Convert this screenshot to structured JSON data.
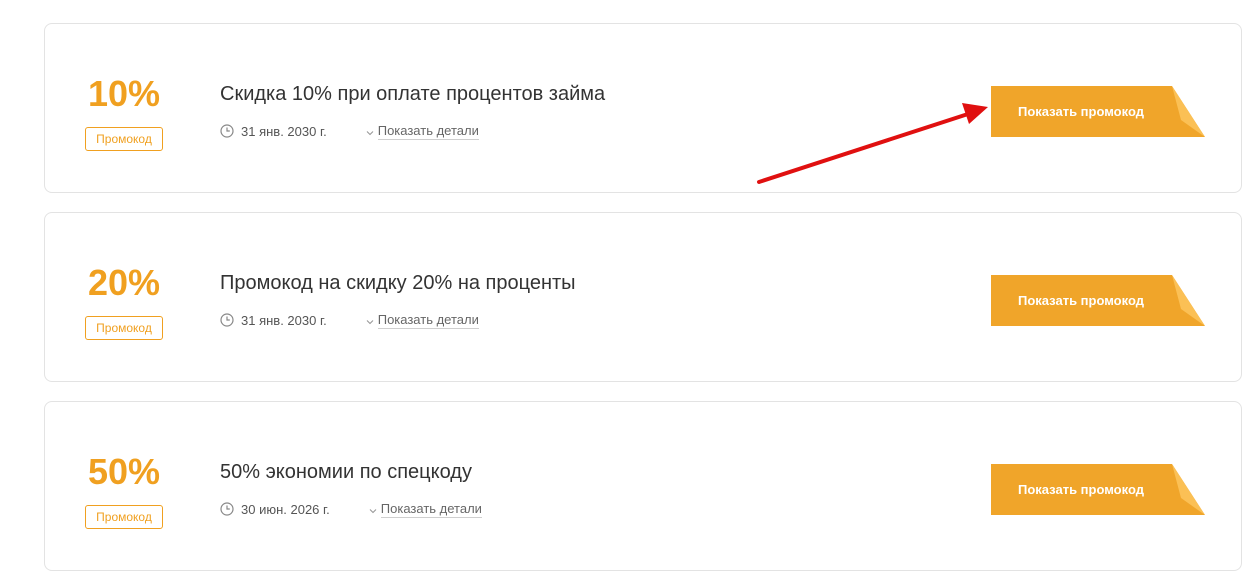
{
  "offers": [
    {
      "percent": "10%",
      "tag": "Промокод",
      "title": "Скидка 10% при оплате процентов займа",
      "date": "31 янв. 2030 г.",
      "details": "Показать детали",
      "button": "Показать промокод"
    },
    {
      "percent": "20%",
      "tag": "Промокод",
      "title": "Промокод на скидку 20% на проценты",
      "date": "31 янв. 2030 г.",
      "details": "Показать детали",
      "button": "Показать промокод"
    },
    {
      "percent": "50%",
      "tag": "Промокод",
      "title": "50% экономии по спецкоду",
      "date": "30 июн. 2026 г.",
      "details": "Показать детали",
      "button": "Показать промокод"
    }
  ],
  "colors": {
    "accent": "#f0a020",
    "button": "#f0a52a",
    "button_fold": "#fbc055",
    "arrow": "#e01010"
  },
  "icons": {
    "date": "clock-icon",
    "details": "chevron-down-icon"
  }
}
